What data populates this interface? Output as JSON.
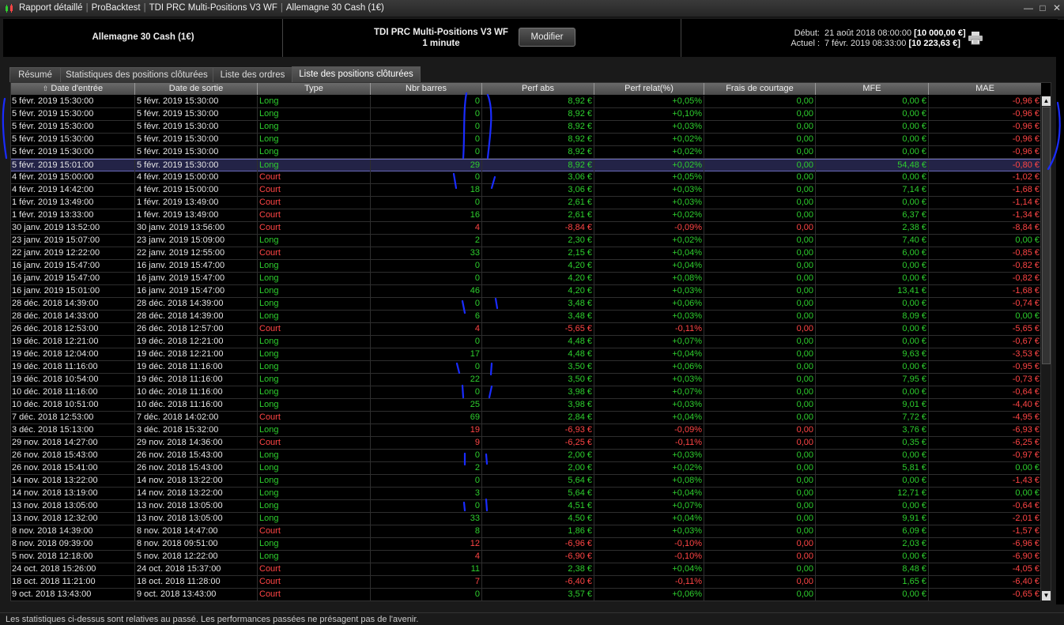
{
  "titlebar": {
    "breadcrumbs": [
      "Rapport détaillé",
      "ProBacktest",
      "TDI PRC Multi-Positions V3 WF",
      "Allemagne 30 Cash (1€)"
    ],
    "minimize": "—",
    "maximize": "□",
    "close": "✕"
  },
  "header": {
    "instrument": "Allemagne 30 Cash (1€)",
    "strategy_name": "TDI PRC Multi-Positions V3 WF",
    "timeframe": "1 minute",
    "modify_label": "Modifier",
    "start_label": "Début:",
    "start_date": "21 août 2018 08:00:00",
    "start_capital": "[10 000,00 €]",
    "current_label": "Actuel :",
    "current_date": "7 févr. 2019 08:33:00",
    "current_capital": "[10 223,63 €]"
  },
  "tabs": [
    {
      "label": "Résumé"
    },
    {
      "label": "Statistiques des positions clôturées"
    },
    {
      "label": "Liste des ordres"
    },
    {
      "label": "Liste des positions clôturées",
      "active": true
    }
  ],
  "table": {
    "columns": [
      "Date d'entrée",
      "Date de sortie",
      "Type",
      "Nbr barres",
      "Perf abs",
      "Perf relat(%)",
      "Frais de courtage",
      "MFE",
      "MAE"
    ],
    "rows": [
      [
        "5 févr. 2019 15:30:00",
        "5 févr. 2019 15:30:00",
        "Long",
        "0",
        "8,92 €",
        "+0,05%",
        "0,00",
        "0,00 €",
        "-0,96 €"
      ],
      [
        "5 févr. 2019 15:30:00",
        "5 févr. 2019 15:30:00",
        "Long",
        "0",
        "8,92 €",
        "+0,10%",
        "0,00",
        "0,00 €",
        "-0,96 €"
      ],
      [
        "5 févr. 2019 15:30:00",
        "5 févr. 2019 15:30:00",
        "Long",
        "0",
        "8,92 €",
        "+0,03%",
        "0,00",
        "0,00 €",
        "-0,96 €"
      ],
      [
        "5 févr. 2019 15:30:00",
        "5 févr. 2019 15:30:00",
        "Long",
        "0",
        "8,92 €",
        "+0,02%",
        "0,00",
        "0,00 €",
        "-0,96 €"
      ],
      [
        "5 févr. 2019 15:30:00",
        "5 févr. 2019 15:30:00",
        "Long",
        "0",
        "8,92 €",
        "+0,02%",
        "0,00",
        "0,00 €",
        "-0,96 €"
      ],
      [
        "5 févr. 2019 15:01:00",
        "5 févr. 2019 15:30:00",
        "Long",
        "29",
        "8,92 €",
        "+0,02%",
        "0,00",
        "54,48 €",
        "-0,80 €"
      ],
      [
        "4 févr. 2019 15:00:00",
        "4 févr. 2019 15:00:00",
        "Court",
        "0",
        "3,06 €",
        "+0,05%",
        "0,00",
        "0,00 €",
        "-1,02 €"
      ],
      [
        "4 févr. 2019 14:42:00",
        "4 févr. 2019 15:00:00",
        "Court",
        "18",
        "3,06 €",
        "+0,03%",
        "0,00",
        "7,14 €",
        "-1,68 €"
      ],
      [
        "1 févr. 2019 13:49:00",
        "1 févr. 2019 13:49:00",
        "Court",
        "0",
        "2,61 €",
        "+0,03%",
        "0,00",
        "0,00 €",
        "-1,14 €"
      ],
      [
        "1 févr. 2019 13:33:00",
        "1 févr. 2019 13:49:00",
        "Court",
        "16",
        "2,61 €",
        "+0,02%",
        "0,00",
        "6,37 €",
        "-1,34 €"
      ],
      [
        "30 janv. 2019 13:52:00",
        "30 janv. 2019 13:56:00",
        "Court",
        "4",
        "-8,84 €",
        "-0,09%",
        "0,00",
        "2,38 €",
        "-8,84 €"
      ],
      [
        "23 janv. 2019 15:07:00",
        "23 janv. 2019 15:09:00",
        "Long",
        "2",
        "2,30 €",
        "+0,02%",
        "0,00",
        "7,40 €",
        "0,00 €"
      ],
      [
        "22 janv. 2019 12:22:00",
        "22 janv. 2019 12:55:00",
        "Court",
        "33",
        "2,15 €",
        "+0,04%",
        "0,00",
        "6,00 €",
        "-0,85 €"
      ],
      [
        "16 janv. 2019 15:47:00",
        "16 janv. 2019 15:47:00",
        "Long",
        "0",
        "4,20 €",
        "+0,04%",
        "0,00",
        "0,00 €",
        "-0,82 €"
      ],
      [
        "16 janv. 2019 15:47:00",
        "16 janv. 2019 15:47:00",
        "Long",
        "0",
        "4,20 €",
        "+0,08%",
        "0,00",
        "0,00 €",
        "-0,82 €"
      ],
      [
        "16 janv. 2019 15:01:00",
        "16 janv. 2019 15:47:00",
        "Long",
        "46",
        "4,20 €",
        "+0,03%",
        "0,00",
        "13,41 €",
        "-1,68 €"
      ],
      [
        "28 déc. 2018 14:39:00",
        "28 déc. 2018 14:39:00",
        "Long",
        "0",
        "3,48 €",
        "+0,06%",
        "0,00",
        "0,00 €",
        "-0,74 €"
      ],
      [
        "28 déc. 2018 14:33:00",
        "28 déc. 2018 14:39:00",
        "Long",
        "6",
        "3,48 €",
        "+0,03%",
        "0,00",
        "8,09 €",
        "0,00 €"
      ],
      [
        "26 déc. 2018 12:53:00",
        "26 déc. 2018 12:57:00",
        "Court",
        "4",
        "-5,65 €",
        "-0,11%",
        "0,00",
        "0,00 €",
        "-5,65 €"
      ],
      [
        "19 déc. 2018 12:21:00",
        "19 déc. 2018 12:21:00",
        "Long",
        "0",
        "4,48 €",
        "+0,07%",
        "0,00",
        "0,00 €",
        "-0,67 €"
      ],
      [
        "19 déc. 2018 12:04:00",
        "19 déc. 2018 12:21:00",
        "Long",
        "17",
        "4,48 €",
        "+0,04%",
        "0,00",
        "9,63 €",
        "-3,53 €"
      ],
      [
        "19 déc. 2018 11:16:00",
        "19 déc. 2018 11:16:00",
        "Long",
        "0",
        "3,50 €",
        "+0,06%",
        "0,00",
        "0,00 €",
        "-0,95 €"
      ],
      [
        "19 déc. 2018 10:54:00",
        "19 déc. 2018 11:16:00",
        "Long",
        "22",
        "3,50 €",
        "+0,03%",
        "0,00",
        "7,95 €",
        "-0,73 €"
      ],
      [
        "10 déc. 2018 11:16:00",
        "10 déc. 2018 11:16:00",
        "Long",
        "0",
        "3,98 €",
        "+0,07%",
        "0,00",
        "0,00 €",
        "-0,64 €"
      ],
      [
        "10 déc. 2018 10:51:00",
        "10 déc. 2018 11:16:00",
        "Long",
        "25",
        "3,98 €",
        "+0,03%",
        "0,00",
        "9,01 €",
        "-4,40 €"
      ],
      [
        "7 déc. 2018 12:53:00",
        "7 déc. 2018 14:02:00",
        "Court",
        "69",
        "2,84 €",
        "+0,04%",
        "0,00",
        "7,72 €",
        "-4,95 €"
      ],
      [
        "3 déc. 2018 15:13:00",
        "3 déc. 2018 15:32:00",
        "Long",
        "19",
        "-6,93 €",
        "-0,09%",
        "0,00",
        "3,76 €",
        "-6,93 €"
      ],
      [
        "29 nov. 2018 14:27:00",
        "29 nov. 2018 14:36:00",
        "Court",
        "9",
        "-6,25 €",
        "-0,11%",
        "0,00",
        "0,35 €",
        "-6,25 €"
      ],
      [
        "26 nov. 2018 15:43:00",
        "26 nov. 2018 15:43:00",
        "Long",
        "0",
        "2,00 €",
        "+0,03%",
        "0,00",
        "0,00 €",
        "-0,97 €"
      ],
      [
        "26 nov. 2018 15:41:00",
        "26 nov. 2018 15:43:00",
        "Long",
        "2",
        "2,00 €",
        "+0,02%",
        "0,00",
        "5,81 €",
        "0,00 €"
      ],
      [
        "14 nov. 2018 13:22:00",
        "14 nov. 2018 13:22:00",
        "Long",
        "0",
        "5,64 €",
        "+0,08%",
        "0,00",
        "0,00 €",
        "-1,43 €"
      ],
      [
        "14 nov. 2018 13:19:00",
        "14 nov. 2018 13:22:00",
        "Long",
        "3",
        "5,64 €",
        "+0,04%",
        "0,00",
        "12,71 €",
        "0,00 €"
      ],
      [
        "13 nov. 2018 13:05:00",
        "13 nov. 2018 13:05:00",
        "Long",
        "0",
        "4,51 €",
        "+0,07%",
        "0,00",
        "0,00 €",
        "-0,64 €"
      ],
      [
        "13 nov. 2018 12:32:00",
        "13 nov. 2018 13:05:00",
        "Long",
        "33",
        "4,50 €",
        "+0,04%",
        "0,00",
        "9,91 €",
        "-2,01 €"
      ],
      [
        "8 nov. 2018 14:39:00",
        "8 nov. 2018 14:47:00",
        "Court",
        "8",
        "1,86 €",
        "+0,03%",
        "0,00",
        "6,09 €",
        "-1,57 €"
      ],
      [
        "8 nov. 2018 09:39:00",
        "8 nov. 2018 09:51:00",
        "Long",
        "12",
        "-6,96 €",
        "-0,10%",
        "0,00",
        "2,03 €",
        "-6,96 €"
      ],
      [
        "5 nov. 2018 12:18:00",
        "5 nov. 2018 12:22:00",
        "Long",
        "4",
        "-6,90 €",
        "-0,10%",
        "0,00",
        "0,00 €",
        "-6,90 €"
      ],
      [
        "24 oct. 2018 15:26:00",
        "24 oct. 2018 15:37:00",
        "Court",
        "11",
        "2,38 €",
        "+0,04%",
        "0,00",
        "8,48 €",
        "-4,05 €"
      ],
      [
        "18 oct. 2018 11:21:00",
        "18 oct. 2018 11:28:00",
        "Court",
        "7",
        "-6,40 €",
        "-0,11%",
        "0,00",
        "1,65 €",
        "-6,40 €"
      ],
      [
        "9 oct. 2018 13:43:00",
        "9 oct. 2018 13:43:00",
        "Court",
        "0",
        "3,57 €",
        "+0,06%",
        "0,00",
        "0,00 €",
        "-0,65 €"
      ]
    ],
    "selected_row": 5
  },
  "scrollbar": {
    "up": "▲",
    "down": "▼"
  },
  "footer": {
    "disclaimer": "Les statistiques ci-dessus sont relatives au passé. Les performances passées ne présagent pas de l'avenir."
  },
  "colors": {
    "long": "#2ecf2e",
    "court": "#ff4545",
    "positive": "#2ecf2e",
    "negative": "#ff4545",
    "selection": "#232347",
    "pen": "#1a2cff"
  }
}
